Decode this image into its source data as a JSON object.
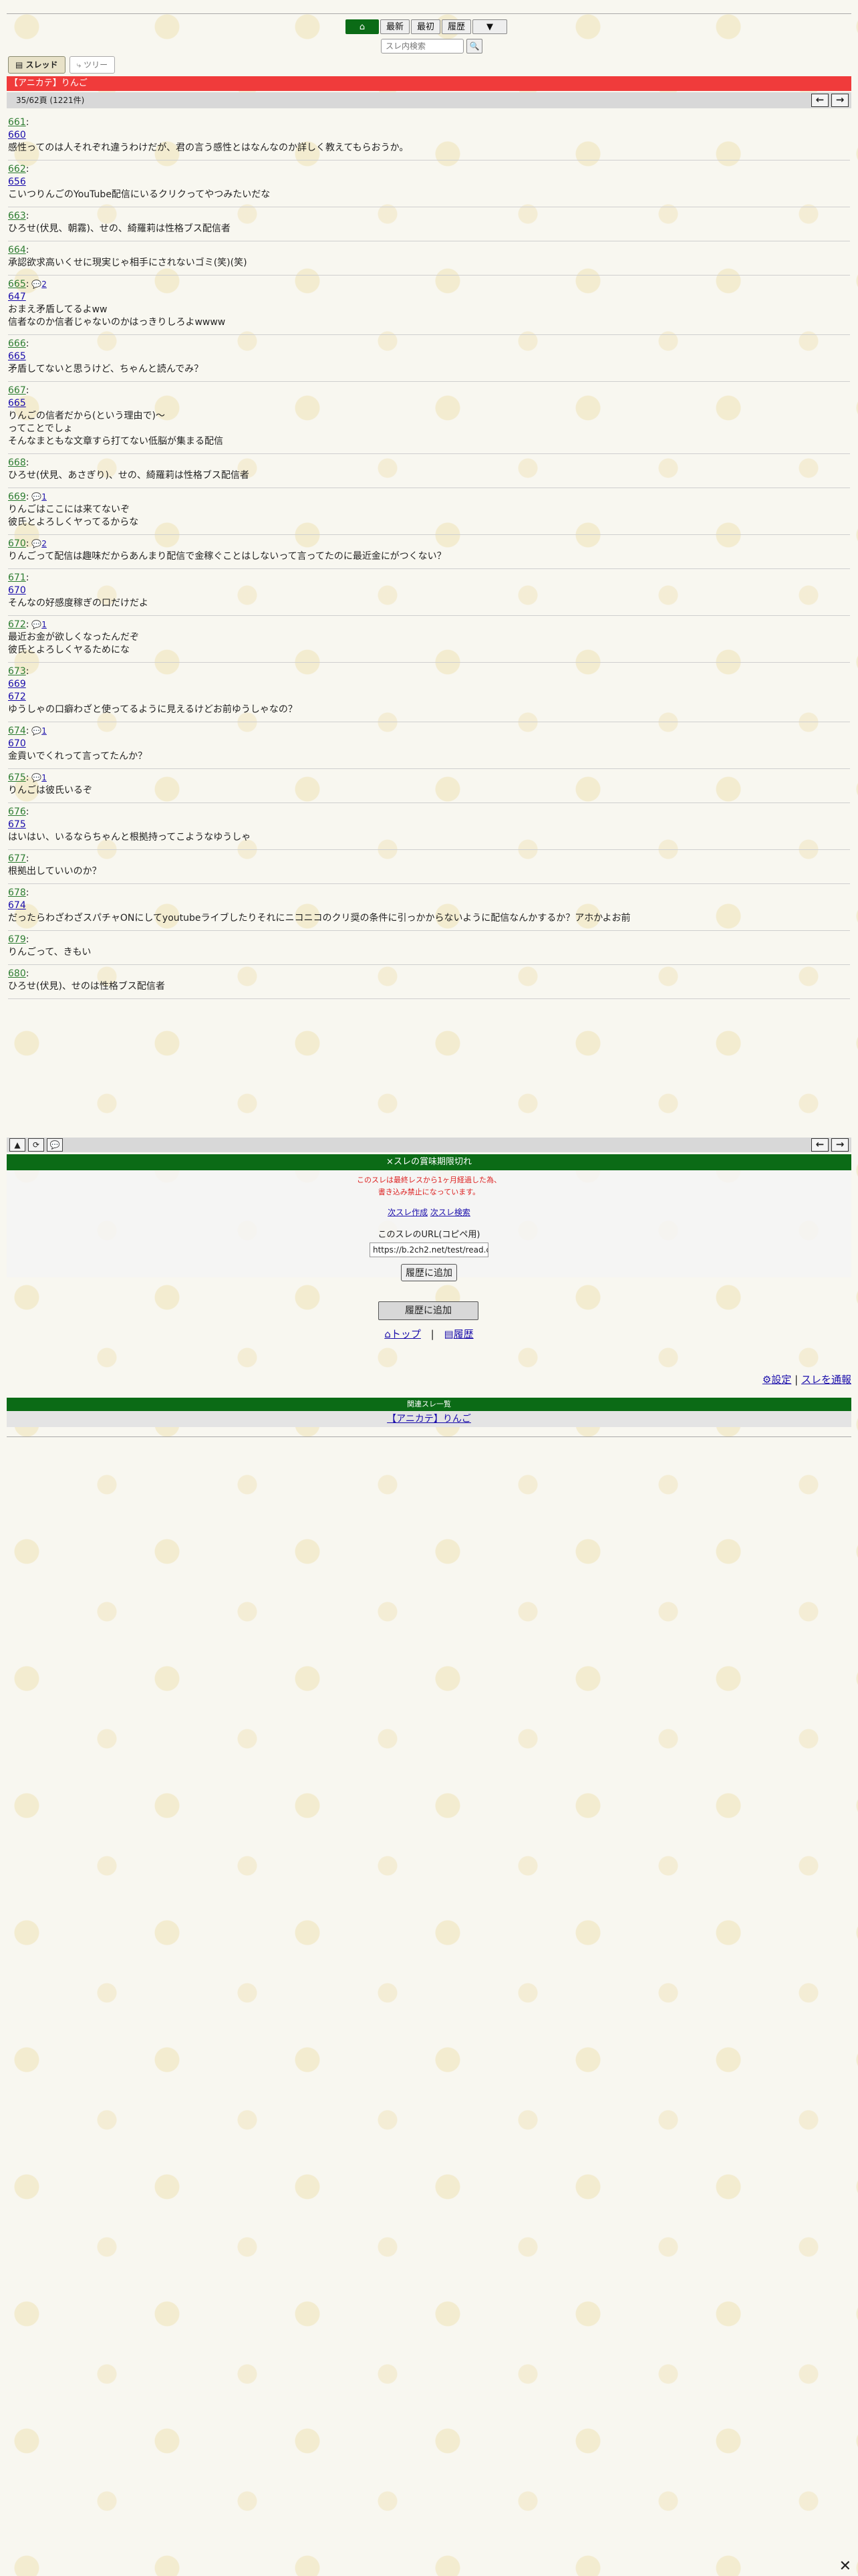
{
  "nav": {
    "home": "⌂",
    "latest": "最新",
    "latest50": "最初",
    "history": "履歴",
    "menu": "▼",
    "search_placeholder": "スレ内検索",
    "search_btn": "🔍"
  },
  "modes": {
    "thread": "スレッド",
    "tree": "ツリー"
  },
  "thread": {
    "title": "【アニカテ】りんご",
    "page_info": "35/62頁 (1221件)"
  },
  "posts": [
    {
      "num": "661",
      "anchors": [
        "660"
      ],
      "lines": [
        "感性ってのは人それぞれ違うわけだが、君の言う感性とはなんなのか詳しく教えてもらおうか。"
      ]
    },
    {
      "num": "662",
      "anchors": [
        "656"
      ],
      "lines": [
        "こいつりんごのYouTube配信にいるクリクってやつみたいだな"
      ]
    },
    {
      "num": "663",
      "anchors": [],
      "lines": [
        "ひろせ(伏見、朝霧)、せの、綺羅莉は性格ブス配信者"
      ]
    },
    {
      "num": "664",
      "anchors": [],
      "lines": [
        "承認欲求高いくせに現実じゃ相手にされないゴミ(笑)(笑)"
      ]
    },
    {
      "num": "665",
      "reply": "2",
      "anchors": [
        "647"
      ],
      "lines": [
        "おまえ矛盾してるよww",
        "信者なのか信者じゃないのかはっきりしろよwwww"
      ]
    },
    {
      "num": "666",
      "anchors": [
        "665"
      ],
      "lines": [
        "矛盾してないと思うけど、ちゃんと読んでみ？"
      ]
    },
    {
      "num": "667",
      "anchors": [
        "665"
      ],
      "lines": [
        "りんごの信者だから(という理由で)〜",
        "ってことでしょ",
        "そんなまともな文章すら打てない低脳が集まる配信"
      ]
    },
    {
      "num": "668",
      "anchors": [],
      "lines": [
        "ひろせ(伏見、あさぎり)、せの、綺羅莉は性格ブス配信者"
      ]
    },
    {
      "num": "669",
      "reply": "1",
      "anchors": [],
      "lines": [
        "りんごはここには来てないぞ",
        "彼氏とよろしくヤってるからな"
      ]
    },
    {
      "num": "670",
      "reply": "2",
      "anchors": [],
      "lines": [
        "りんごって配信は趣味だからあんまり配信で金稼ぐことはしないって言ってたのに最近金にがつくない？"
      ]
    },
    {
      "num": "671",
      "anchors": [
        "670"
      ],
      "lines": [
        "そんなの好感度稼ぎの口だけだよ"
      ]
    },
    {
      "num": "672",
      "reply": "1",
      "anchors": [],
      "lines": [
        "最近お金が欲しくなったんだぞ",
        "彼氏とよろしくヤるためにな"
      ]
    },
    {
      "num": "673",
      "anchors": [
        "669",
        "672"
      ],
      "lines": [
        "ゆうしゃの口癖わざと使ってるように見えるけどお前ゆうしゃなの？"
      ]
    },
    {
      "num": "674",
      "reply": "1",
      "anchors": [
        "670"
      ],
      "lines": [
        "金貢いでくれって言ってたんか？"
      ]
    },
    {
      "num": "675",
      "reply": "1",
      "anchors": [],
      "lines": [
        "りんごは彼氏いるぞ"
      ]
    },
    {
      "num": "676",
      "anchors": [
        "675"
      ],
      "lines": [
        "はいはい、いるならちゃんと根拠持ってこようなゆうしゃ"
      ]
    },
    {
      "num": "677",
      "anchors": [],
      "lines": [
        "根拠出していいのか？"
      ]
    },
    {
      "num": "678",
      "anchors": [
        "674"
      ],
      "lines": [
        "だったらわざわざスパチャONにしてyoutubeライブしたりそれにニコニコのクリ奨の条件に引っかからないように配信なんかするか？アホかよお前"
      ]
    },
    {
      "num": "679",
      "anchors": [],
      "lines": [
        "りんごって、きもい"
      ]
    },
    {
      "num": "680",
      "anchors": [],
      "lines": [
        "ひろせ(伏見)、せのは性格ブス配信者"
      ]
    }
  ],
  "toolbar": {
    "up": "▲",
    "reload": "⟳",
    "badge": "💬"
  },
  "expired": {
    "banner": "×スレの賞味期限切れ",
    "warn1": "このスレは最終レスから1ヶ月経過した為、",
    "warn2": "書き込み禁止になっています。",
    "new_thread": "次スレ作成",
    "search_next": "次スレ検索",
    "url_caption": "このスレのURL(コピペ用)",
    "url": "https://b.2ch2.net/test/read.cgi",
    "add_history": "履歴に追加"
  },
  "footer": {
    "add_history": "履歴に追加",
    "top": "トップ",
    "history": "履歴",
    "separator": "|",
    "settings": "設定",
    "report": "スレを通報",
    "related_head": "関連スレ一覧",
    "related_item": "【アニカテ】りんご",
    "close": "✕"
  }
}
